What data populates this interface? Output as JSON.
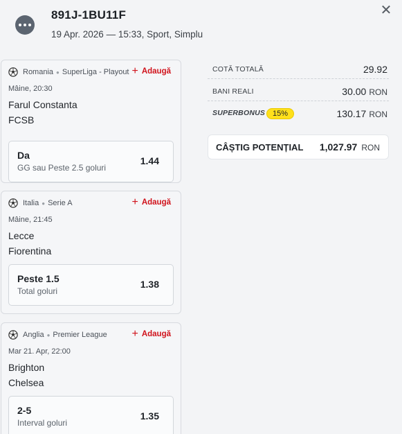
{
  "header": {
    "ticket_id": "891J-1BU11F",
    "meta": "19 Apr. 2026 — 15:33, Sport, Simplu",
    "menu_icon": "more-dots-icon",
    "close_icon": "close-icon"
  },
  "bets": [
    {
      "country": "Romania",
      "league": "SuperLiga - Playout",
      "add_label": "Adaugă",
      "time": "Mâine, 20:30",
      "home": "Farul Constanta",
      "away": "FCSB",
      "selection": "Da",
      "market": "GG sau Peste 2.5 goluri",
      "odds": "1.44"
    },
    {
      "country": "Italia",
      "league": "Serie A",
      "add_label": "Adaugă",
      "time": "Mâine, 21:45",
      "home": "Lecce",
      "away": "Fiorentina",
      "selection": "Peste 1.5",
      "market": "Total goluri",
      "odds": "1.38"
    },
    {
      "country": "Anglia",
      "league": "Premier League",
      "add_label": "Adaugă",
      "time": "Mar 21. Apr, 22:00",
      "home": "Brighton",
      "away": "Chelsea",
      "selection": "2-5",
      "market": "Interval goluri",
      "odds": "1.35"
    }
  ],
  "summary": {
    "total_odds_label": "COTĂ TOTALĂ",
    "total_odds_value": "29.92",
    "real_money_label": "BANI REALI",
    "real_money_value": "30.00",
    "currency": "RON",
    "superbonus_label": "SUPERBONUS",
    "superbonus_pct": "15%",
    "superbonus_value": "130.17",
    "potential_label": "CÂȘTIG POTENȚIAL",
    "potential_value": "1,027.97"
  },
  "colors": {
    "accent_red": "#d0121b",
    "superbonus_yellow": "#ffe01b",
    "background": "#f3f4f6"
  }
}
